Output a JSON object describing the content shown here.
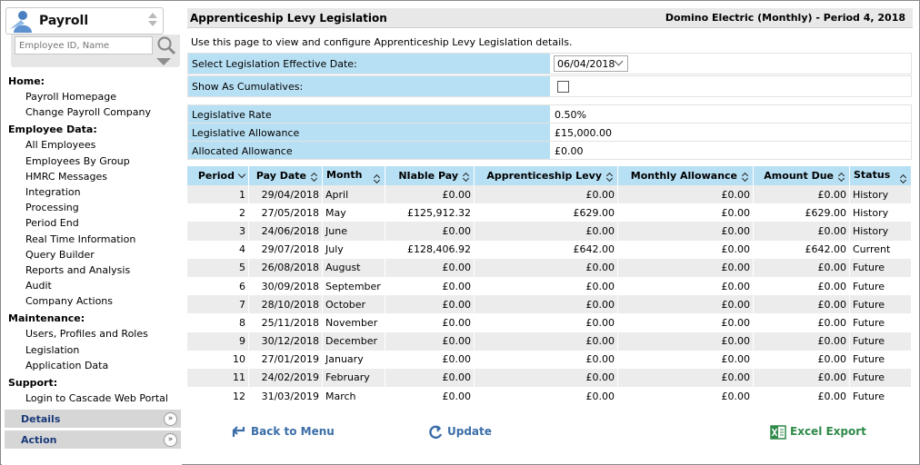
{
  "app": {
    "title": "Payroll",
    "search_placeholder": "Employee ID, Name"
  },
  "nav": [
    {
      "heading": "Home:",
      "items": [
        "Payroll Homepage",
        "Change Payroll Company"
      ]
    },
    {
      "heading": "Employee Data:",
      "items": [
        "All Employees",
        "Employees By Group",
        "HMRC Messages",
        "Integration",
        "Processing",
        "Period End",
        "Real Time Information",
        "Query Builder",
        "Reports and Analysis",
        "Audit",
        "Company Actions"
      ]
    },
    {
      "heading": "Maintenance:",
      "items": [
        "Users, Profiles and Roles",
        "Legislation",
        "Application Data"
      ]
    },
    {
      "heading": "Support:",
      "items": [
        "Login to Cascade Web Portal"
      ]
    }
  ],
  "accordions": {
    "details": "Details",
    "action": "Action"
  },
  "page": {
    "title": "Apprenticeship Levy Legislation",
    "company": "Domino Electric (Monthly) - Period 4, 2018",
    "intro": "Use this page to view and configure Apprenticeship Levy Legislation details."
  },
  "form": {
    "effective_date_label": "Select Legislation Effective Date:",
    "effective_date_value": "06/04/2018",
    "cumulatives_label": "Show As Cumulatives:",
    "cumulatives_checked": false
  },
  "summary": [
    {
      "label": "Legislative Rate",
      "value": "0.50%"
    },
    {
      "label": "Legislative Allowance",
      "value": "£15,000.00"
    },
    {
      "label": "Allocated Allowance",
      "value": "£0.00"
    }
  ],
  "table": {
    "columns": [
      "Period",
      "Pay Date",
      "Month",
      "NIable Pay",
      "Apprenticeship Levy",
      "Monthly Allowance",
      "Amount Due",
      "Status"
    ],
    "rows": [
      [
        "1",
        "29/04/2018",
        "April",
        "£0.00",
        "£0.00",
        "£0.00",
        "£0.00",
        "History"
      ],
      [
        "2",
        "27/05/2018",
        "May",
        "£125,912.32",
        "£629.00",
        "£0.00",
        "£629.00",
        "History"
      ],
      [
        "3",
        "24/06/2018",
        "June",
        "£0.00",
        "£0.00",
        "£0.00",
        "£0.00",
        "History"
      ],
      [
        "4",
        "29/07/2018",
        "July",
        "£128,406.92",
        "£642.00",
        "£0.00",
        "£642.00",
        "Current"
      ],
      [
        "5",
        "26/08/2018",
        "August",
        "£0.00",
        "£0.00",
        "£0.00",
        "£0.00",
        "Future"
      ],
      [
        "6",
        "30/09/2018",
        "September",
        "£0.00",
        "£0.00",
        "£0.00",
        "£0.00",
        "Future"
      ],
      [
        "7",
        "28/10/2018",
        "October",
        "£0.00",
        "£0.00",
        "£0.00",
        "£0.00",
        "Future"
      ],
      [
        "8",
        "25/11/2018",
        "November",
        "£0.00",
        "£0.00",
        "£0.00",
        "£0.00",
        "Future"
      ],
      [
        "9",
        "30/12/2018",
        "December",
        "£0.00",
        "£0.00",
        "£0.00",
        "£0.00",
        "Future"
      ],
      [
        "10",
        "27/01/2019",
        "January",
        "£0.00",
        "£0.00",
        "£0.00",
        "£0.00",
        "Future"
      ],
      [
        "11",
        "24/02/2019",
        "February",
        "£0.00",
        "£0.00",
        "£0.00",
        "£0.00",
        "Future"
      ],
      [
        "12",
        "31/03/2019",
        "March",
        "£0.00",
        "£0.00",
        "£0.00",
        "£0.00",
        "Future"
      ]
    ]
  },
  "actions": {
    "back": "Back to Menu",
    "update": "Update",
    "export": "Excel Export"
  },
  "colors": {
    "header_blue": "#b8e0f4",
    "link_blue": "#3b6ea8",
    "export_green": "#2f8a4a"
  }
}
